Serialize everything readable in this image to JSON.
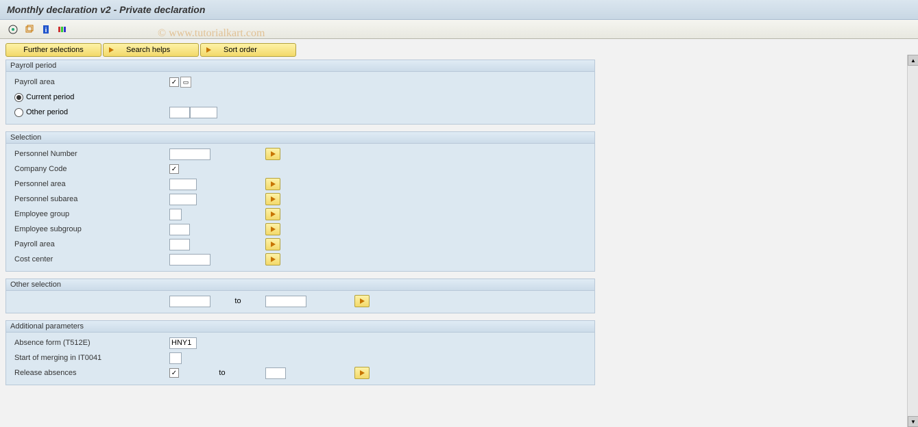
{
  "title": "Monthly declaration v2 - Private declaration",
  "watermark": "© www.tutorialkart.com",
  "toolbar_buttons": {
    "further_selections": "Further selections",
    "search_helps": "Search helps",
    "sort_order": "Sort order"
  },
  "groups": {
    "payroll_period": {
      "title": "Payroll period",
      "payroll_area_label": "Payroll area",
      "payroll_area_value": "",
      "current_period_label": "Current period",
      "other_period_label": "Other period",
      "other_period_val1": "",
      "other_period_val2": "",
      "period_selected": "current"
    },
    "selection": {
      "title": "Selection",
      "rows": [
        {
          "label": "Personnel Number",
          "value": "",
          "width": "w60",
          "multi": true
        },
        {
          "label": "Company Code",
          "value": "",
          "width": "w30",
          "multi": false,
          "check": true
        },
        {
          "label": "Personnel area",
          "value": "",
          "width": "w40",
          "multi": true
        },
        {
          "label": "Personnel subarea",
          "value": "",
          "width": "w40",
          "multi": true
        },
        {
          "label": "Employee group",
          "value": "",
          "width": "w18",
          "multi": true
        },
        {
          "label": "Employee subgroup",
          "value": "",
          "width": "w30",
          "multi": true
        },
        {
          "label": "Payroll area",
          "value": "",
          "width": "w30",
          "multi": true
        },
        {
          "label": "Cost center",
          "value": "",
          "width": "w60",
          "multi": true
        }
      ]
    },
    "other_selection": {
      "title": "Other selection",
      "from_value": "",
      "to_label": "to",
      "to_value": ""
    },
    "additional_parameters": {
      "title": "Additional parameters",
      "absence_form_label": "Absence form (T512E)",
      "absence_form_value": "HNY1",
      "start_merging_label": "Start of merging in IT0041",
      "start_merging_value": "",
      "release_absences_label": "Release absences",
      "release_absences_checked": true,
      "to_label": "to",
      "release_to_value": ""
    }
  }
}
